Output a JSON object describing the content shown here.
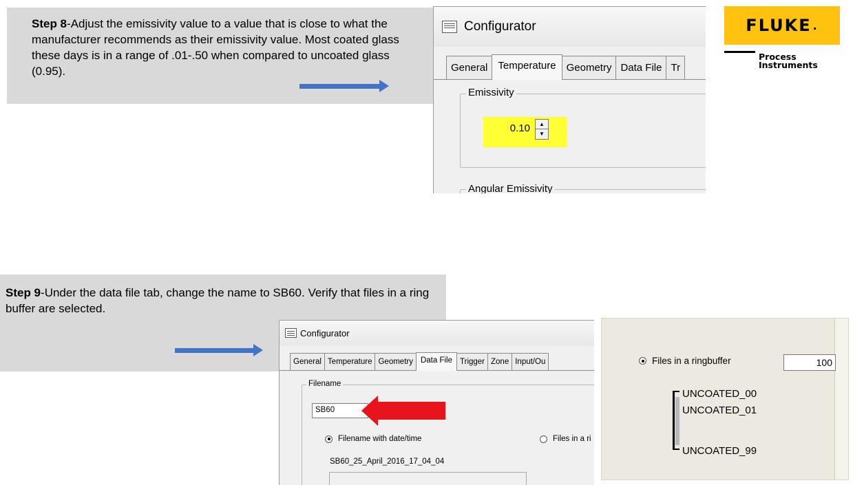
{
  "step8": {
    "label": "Step 8",
    "text": "-Adjust the emissivity value to a value that is close to what the manufacturer recommends as their emissivity value. Most coated glass these days is in a range of .01-.50 when compared to uncoated glass (0.95)."
  },
  "step9": {
    "label": "Step 9",
    "text": "-Under the data file tab, change the name to SB60. Verify that files in a ring buffer are selected."
  },
  "window_top": {
    "title": "Configurator",
    "tabs": [
      "General",
      "Temperature",
      "Geometry",
      "Data File",
      "Tr"
    ],
    "active_tab": "Temperature",
    "emissivity_legend": "Emissivity",
    "emissivity_value": "0.10",
    "angular_legend": "Angular Emissivity",
    "highlight_color": "#ffff33"
  },
  "logo": {
    "brand": "FLUKE",
    "mark": ".",
    "sub_line1": "Process",
    "sub_line2": "Instruments",
    "color": "#ffc20e"
  },
  "window_bottom": {
    "title": "Configurator",
    "tabs": [
      "General",
      "Temperature",
      "Geometry",
      "Data File",
      "Trigger",
      "Zone",
      "Input/Ou"
    ],
    "active_tab": "Data File",
    "filename_legend": "Filename",
    "filename_value": "SB60",
    "radio_datetime": "Filename with date/time",
    "radio_ring": "Files in a ri",
    "preview": "SB60_25_April_2016_17_04_04"
  },
  "zoom": {
    "radio_label": "Files in a ringbuffer",
    "count": "100",
    "items": [
      "UNCOATED_00",
      "UNCOATED_01",
      "UNCOATED_99"
    ]
  },
  "colors": {
    "arrow_blue": "#4472c4",
    "arrow_red": "#e8141b",
    "panel_gray": "#d9d9d9"
  }
}
